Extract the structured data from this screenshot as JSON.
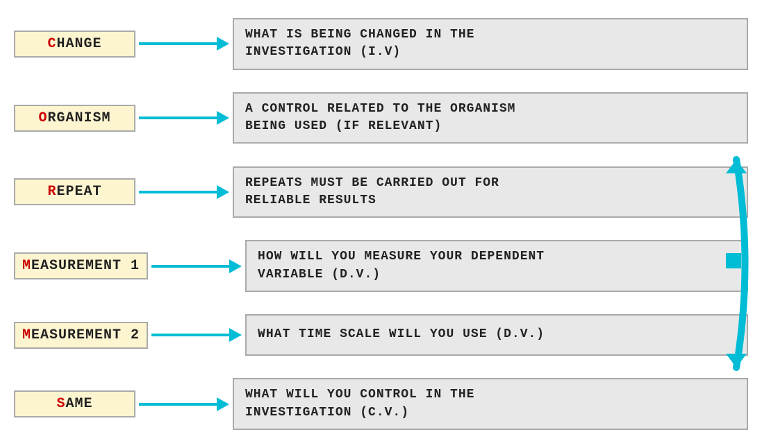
{
  "rows": [
    {
      "id": "change",
      "label": "Change",
      "first": "C",
      "rest": "hange",
      "description": "What is being changed in the\ninvestigation  (I.V)"
    },
    {
      "id": "organism",
      "label": "Organism",
      "first": "O",
      "rest": "rganism",
      "description": "A control related to the organism\nbeing used (if relevant)"
    },
    {
      "id": "repeat",
      "label": "Repeat",
      "first": "R",
      "rest": "epeat",
      "description": "Repeats must be carried out for\nreliable results"
    },
    {
      "id": "measurement1",
      "label": "Measurement 1",
      "first": "M",
      "rest": "easurement 1",
      "description": "How will you measure your dependent\nvariable (D.V.)"
    },
    {
      "id": "measurement2",
      "label": "Measurement 2",
      "first": "M",
      "rest": "easurement 2",
      "description": "What time scale will you use (D.V.)"
    },
    {
      "id": "same",
      "label": "Same",
      "first": "S",
      "rest": "ame",
      "description": "What will you control in the\ninvestigation (C.V.)"
    }
  ],
  "colors": {
    "accent": "#00bcd4",
    "label_bg": "#fdf5d0",
    "desc_bg": "#e8e8e8",
    "first_letter": "#cc0000",
    "border": "#aaa"
  }
}
